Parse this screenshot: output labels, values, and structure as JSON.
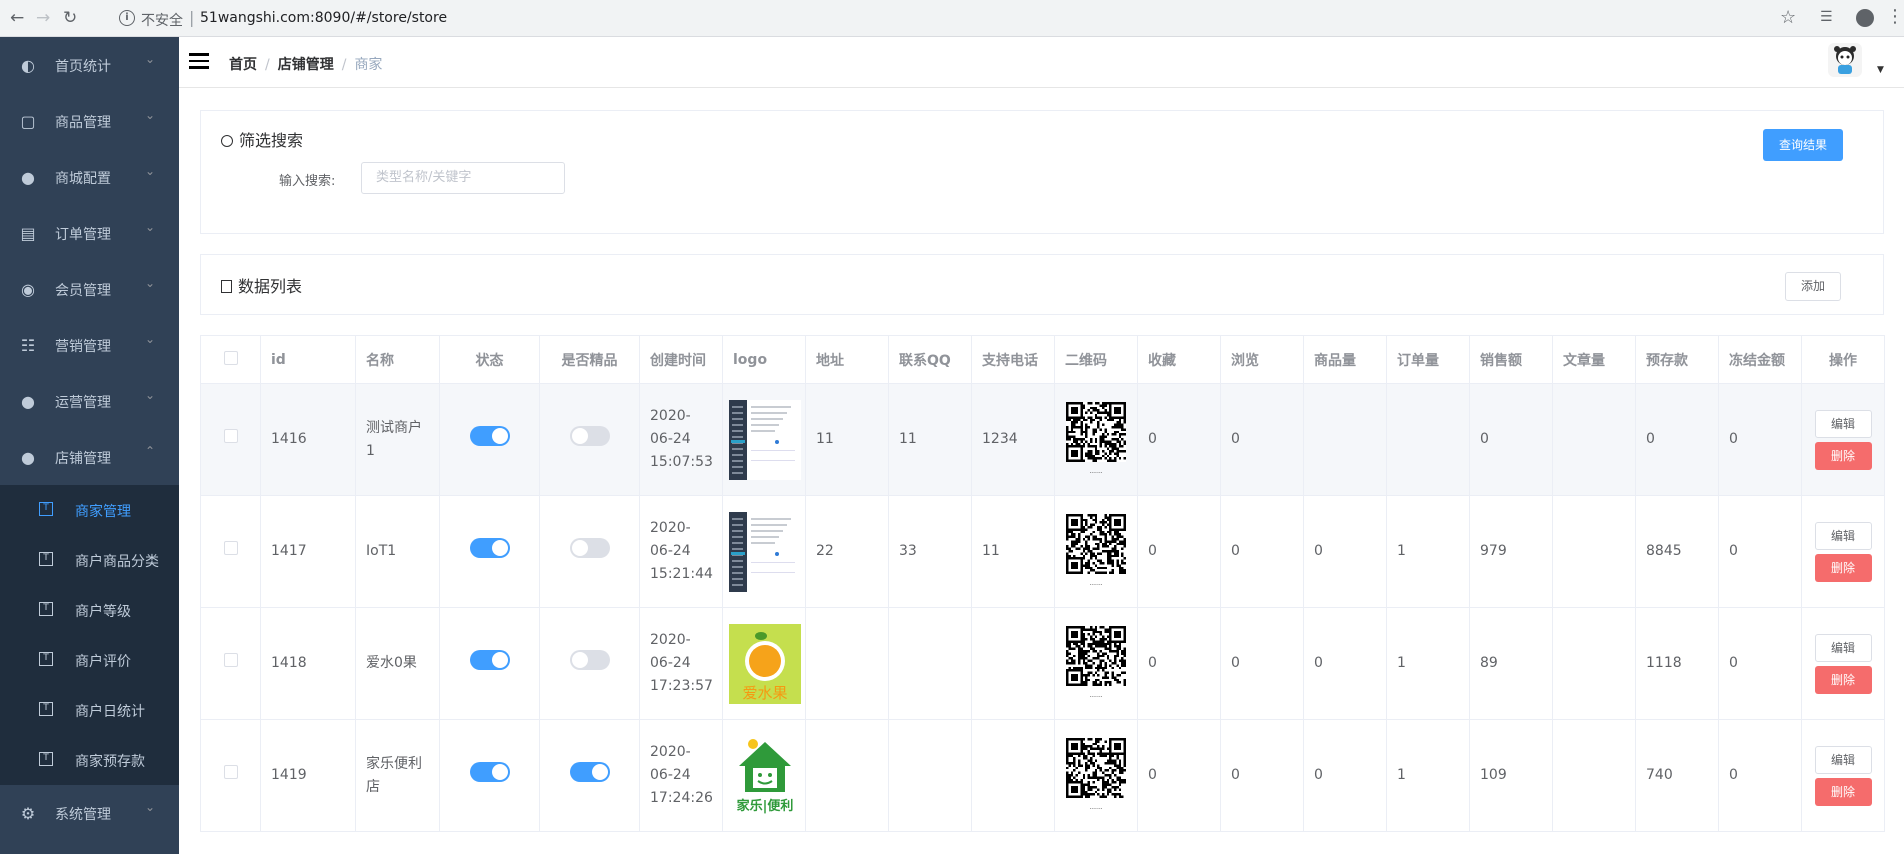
{
  "browser": {
    "insecure_label": "不安全",
    "url": "51wangshi.com:8090/#/store/store"
  },
  "sidebar": {
    "items": [
      {
        "label": "首页统计",
        "icon": "dashboard-icon"
      },
      {
        "label": "商品管理",
        "icon": "monitor-icon"
      },
      {
        "label": "商城配置",
        "icon": "globe-icon"
      },
      {
        "label": "订单管理",
        "icon": "clipboard-icon"
      },
      {
        "label": "会员管理",
        "icon": "github-cat-icon"
      },
      {
        "label": "营销管理",
        "icon": "marketing-icon"
      },
      {
        "label": "运营管理",
        "icon": "globe-icon"
      },
      {
        "label": "店铺管理",
        "icon": "globe-icon"
      }
    ],
    "sub_items": [
      {
        "label": "商家管理",
        "active": true
      },
      {
        "label": "商户商品分类"
      },
      {
        "label": "商户等级"
      },
      {
        "label": "商户评价"
      },
      {
        "label": "商户日统计"
      },
      {
        "label": "商家预存款"
      }
    ],
    "bottom_item": {
      "label": "系统管理",
      "icon": "gear-icon"
    }
  },
  "breadcrumb": {
    "home": "首页",
    "section": "店铺管理",
    "current": "商家",
    "separator": "/"
  },
  "filter": {
    "title": "筛选搜索",
    "query_button": "查询结果",
    "search_label": "输入搜索:",
    "search_placeholder": "类型名称/关键字"
  },
  "list": {
    "title": "数据列表",
    "add_button": "添加"
  },
  "table": {
    "columns": [
      "id",
      "名称",
      "状态",
      "是否精品",
      "创建时间",
      "logo",
      "地址",
      "联系QQ",
      "支持电话",
      "二维码",
      "收藏",
      "浏览",
      "商品量",
      "订单量",
      "销售额",
      "文章量",
      "预存款",
      "冻结金额",
      "操作"
    ],
    "edit_label": "编辑",
    "delete_label": "删除",
    "rows": [
      {
        "id": "1416",
        "name": "测试商户1",
        "status": true,
        "premium": false,
        "created": "2020-06-24 15:07:53",
        "address": "11",
        "qq": "11",
        "phone": "1234",
        "favorites": "0",
        "views": "0",
        "goods": "",
        "orders": "",
        "sales": "0",
        "articles": "",
        "deposit": "0",
        "frozen": "0",
        "logo": "screenshot"
      },
      {
        "id": "1417",
        "name": "IoT1",
        "status": true,
        "premium": false,
        "created": "2020-06-24 15:21:44",
        "address": "22",
        "qq": "33",
        "phone": "11",
        "favorites": "0",
        "views": "0",
        "goods": "0",
        "orders": "1",
        "sales": "979",
        "articles": "",
        "deposit": "8845",
        "frozen": "0",
        "logo": "screenshot"
      },
      {
        "id": "1418",
        "name": "爱水0果",
        "status": true,
        "premium": false,
        "created": "2020-06-24 17:23:57",
        "address": "",
        "qq": "",
        "phone": "",
        "favorites": "0",
        "views": "0",
        "goods": "0",
        "orders": "1",
        "sales": "89",
        "articles": "",
        "deposit": "1118",
        "frozen": "0",
        "logo": "fruit",
        "logo_text": "爱水果"
      },
      {
        "id": "1419",
        "name": "家乐便利店",
        "status": true,
        "premium": true,
        "created": "2020-06-24 17:24:26",
        "address": "",
        "qq": "",
        "phone": "",
        "favorites": "0",
        "views": "0",
        "goods": "0",
        "orders": "1",
        "sales": "109",
        "articles": "",
        "deposit": "740",
        "frozen": "0",
        "logo": "house",
        "logo_text": "家乐|便利"
      }
    ]
  },
  "colors": {
    "sidebar": "#304156",
    "submenu": "#1f2d3d",
    "primary": "#409eff",
    "danger": "#f56c6c"
  }
}
